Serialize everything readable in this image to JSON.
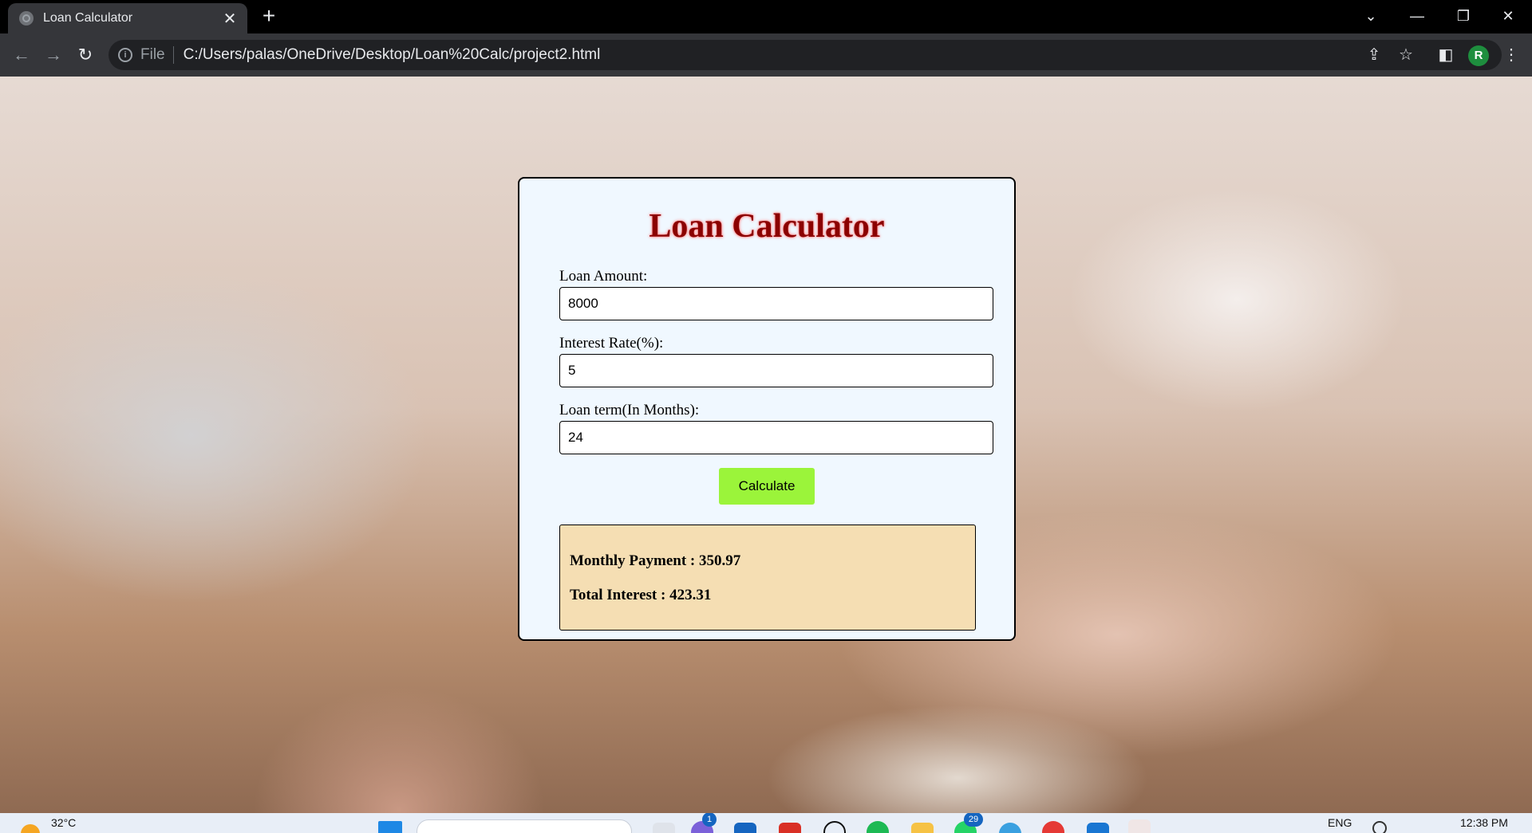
{
  "browser": {
    "tab_title": "Loan Calculator",
    "tab_close": "✕",
    "new_tab": "+",
    "file_label": "File",
    "url": "C:/Users/palas/OneDrive/Desktop/Loan%20Calc/project2.html",
    "profile_initial": "R"
  },
  "page": {
    "heading": "Loan Calculator",
    "fields": [
      {
        "label": "Loan Amount:",
        "value": "8000"
      },
      {
        "label": "Interest Rate(%):",
        "value": "5"
      },
      {
        "label": "Loan term(In Months):",
        "value": "24"
      }
    ],
    "button_label": "Calculate",
    "result": {
      "monthly_payment": "Monthly Payment : 350.97",
      "total_interest": "Total Interest : 423.31"
    },
    "colors": {
      "card_background": "#f0f8ff",
      "heading": "#8b0000",
      "button": "#9bf43a",
      "result_background": "#f5deb3"
    }
  },
  "taskbar": {
    "weather": "32°C",
    "language": "ENG",
    "time": "12:38 PM",
    "badges": [
      "1",
      "29"
    ]
  }
}
